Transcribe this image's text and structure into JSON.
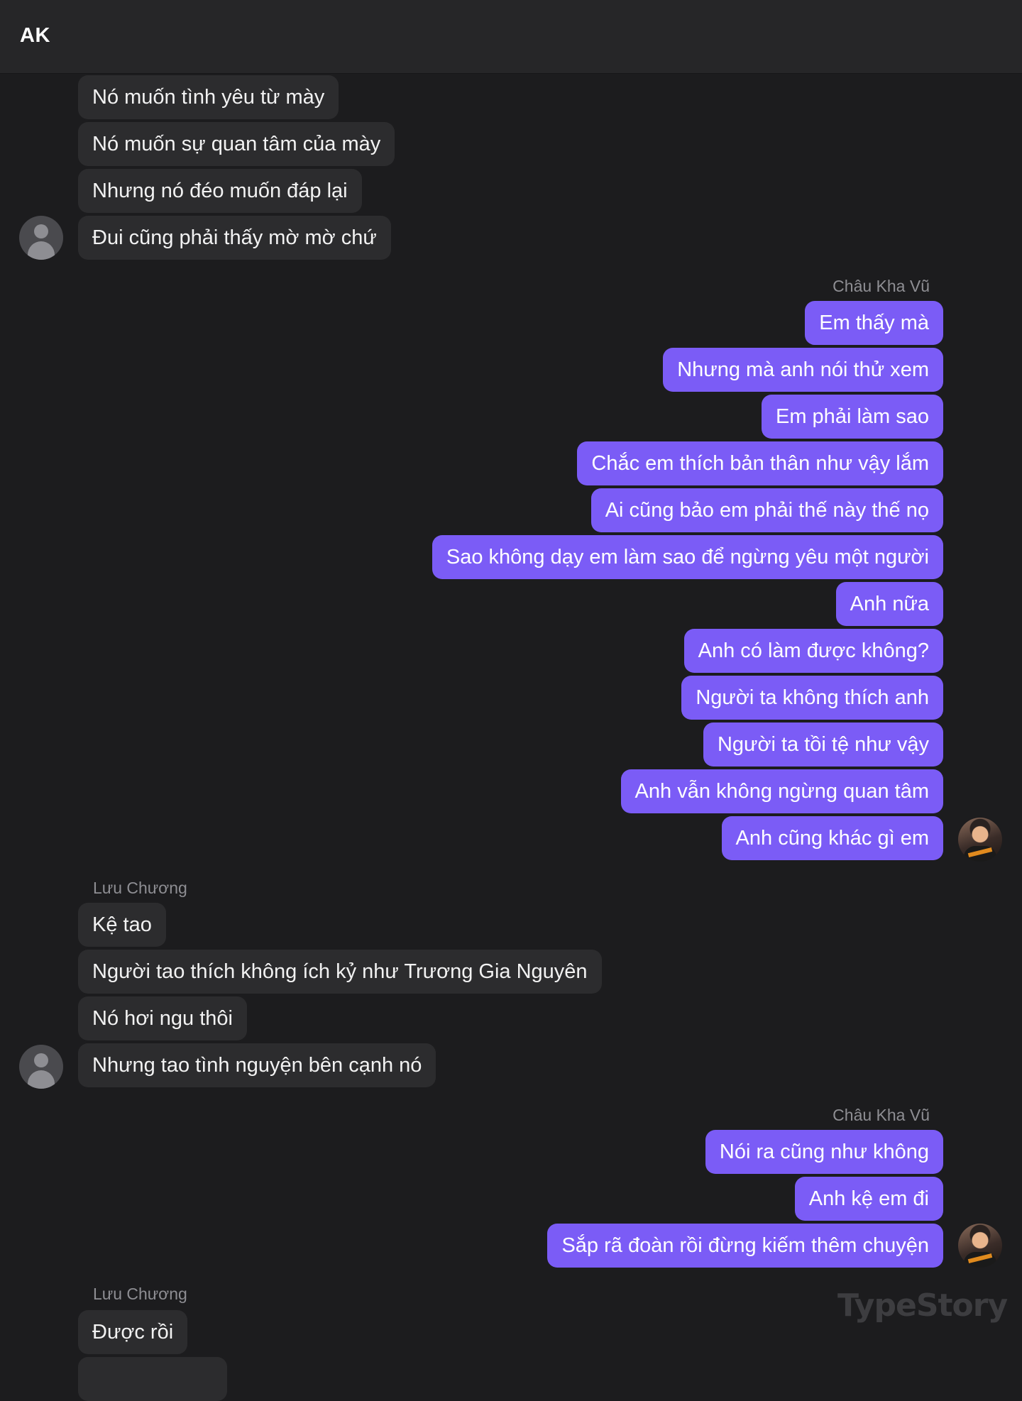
{
  "header": {
    "title": "AK"
  },
  "messages": [
    {
      "text": "Nó muốn tình yêu từ mày"
    },
    {
      "text": "Nó muốn sự quan tâm của mày"
    },
    {
      "text": "Nhưng nó đéo muốn đáp lại"
    },
    {
      "text": "Đui cũng phải thấy mờ mờ chứ"
    },
    {
      "text": "Em thấy mà"
    },
    {
      "text": "Nhưng mà anh nói thử xem"
    },
    {
      "text": "Em phải làm sao"
    },
    {
      "text": "Chắc em thích bản thân như vậy lắm"
    },
    {
      "text": "Ai cũng bảo em phải thế này thế nọ"
    },
    {
      "text": "Sao không dạy em làm sao để ngừng yêu một người"
    },
    {
      "text": "Anh nữa"
    },
    {
      "text": "Anh có làm được không?"
    },
    {
      "text": "Người ta không thích anh"
    },
    {
      "text": "Người ta tồi tệ như vậy"
    },
    {
      "text": "Anh vẫn không ngừng quan tâm"
    },
    {
      "text": "Anh cũng khác gì em"
    },
    {
      "text": "Kệ tao"
    },
    {
      "text": "Người tao thích không ích kỷ như Trương Gia Nguyên"
    },
    {
      "text": "Nó hơi ngu thôi"
    },
    {
      "text": "Nhưng tao tình nguyện bên cạnh nó"
    },
    {
      "text": "Nói ra cũng như không"
    },
    {
      "text": "Anh kệ em đi"
    },
    {
      "text": "Sắp rã đoàn rồi đừng kiếm thêm chuyện"
    },
    {
      "text": "Được rồi"
    }
  ],
  "senders": {
    "chau_kha_vu": "Châu Kha Vũ",
    "luu_chuong": "Lưu Chương"
  },
  "watermark": "TypeStory"
}
